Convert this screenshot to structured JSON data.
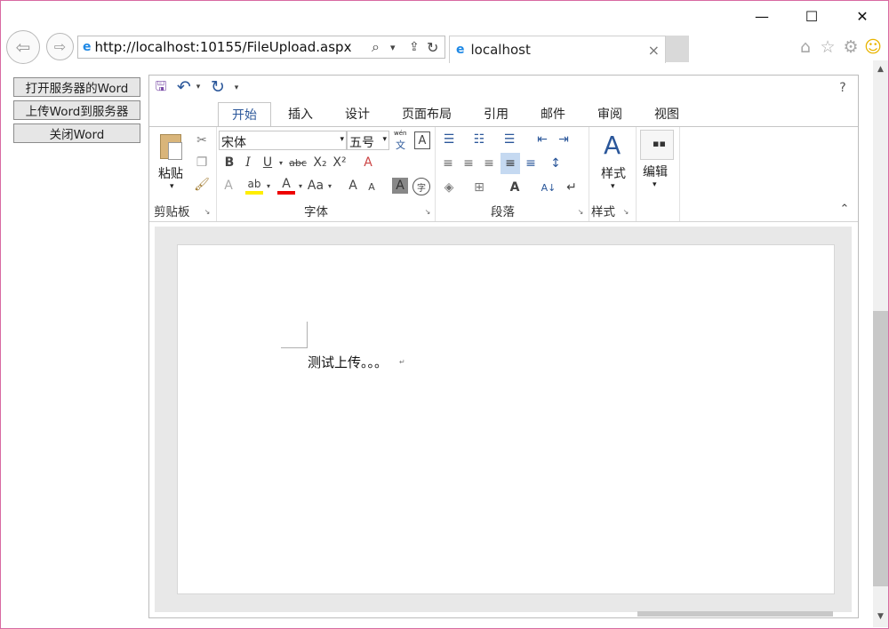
{
  "window": {
    "minimize": "—",
    "maximize": "☐",
    "close": "✕"
  },
  "nav": {
    "back": "⇦",
    "forward": "⇨"
  },
  "address": {
    "url": "http://localhost:10155/FileUpload.aspx",
    "search_icon": "⌕",
    "dropdown": "▾",
    "share": "⇪",
    "refresh": "↻"
  },
  "tab": {
    "title": "localhost",
    "close": "×"
  },
  "right_icons": {
    "home": "⌂",
    "star": "☆",
    "gear": "⚙",
    "smile": "☺"
  },
  "buttons": {
    "open": "打开服务器的Word",
    "upload": "上传Word到服务器",
    "close": "关闭Word"
  },
  "qat": {
    "save": "🖫",
    "undo": "↶",
    "undo_dd": "▾",
    "redo": "↻",
    "customize": "▾",
    "help": "?"
  },
  "ribbon_tabs": [
    "开始",
    "插入",
    "设计",
    "页面布局",
    "引用",
    "邮件",
    "审阅",
    "视图"
  ],
  "clipboard": {
    "label": "剪贴板",
    "paste": "粘贴",
    "paste_dd": "▾",
    "cut": "✂",
    "copy": "❐",
    "format_painter": "🖌",
    "launcher": "↘"
  },
  "font": {
    "label": "字体",
    "name": "宋体",
    "size": "五号",
    "dd": "▾",
    "pinyin_top": "wén",
    "pinyin_bottom": "文",
    "char_border": "A",
    "bold": "B",
    "italic": "I",
    "underline": "U",
    "strike": "abc",
    "sub": "X₂",
    "sup": "X²",
    "clear": "A",
    "effects": "A",
    "highlight": "ab",
    "color": "A",
    "aa": "Aa",
    "grow": "A",
    "shrink": "A",
    "shading": "A",
    "enclose": "字",
    "launcher": "↘"
  },
  "paragraph": {
    "label": "段落",
    "bullets": "☰",
    "numbering": "☷",
    "multilevel": "☰",
    "dec_indent": "⇤",
    "inc_indent": "⇥",
    "left": "≡",
    "center": "≡",
    "right": "≡",
    "justify": "≡",
    "distributed": "≡",
    "spacing": "↕",
    "shading": "◈",
    "borders": "⊞",
    "chinese_layout": "A",
    "sort": "A↓",
    "marks": "↵",
    "launcher": "↘"
  },
  "styles": {
    "label": "样式",
    "btn": "样式",
    "icon": "A",
    "dd": "▾",
    "launcher": "↘"
  },
  "editing": {
    "btn": "编辑",
    "icon": "⬛",
    "dd": "▾"
  },
  "collapse": "⌃",
  "document": {
    "text": "测试上传。。。",
    "para_mark": "↵"
  },
  "scroll": {
    "up": "▲",
    "down": "▼"
  }
}
